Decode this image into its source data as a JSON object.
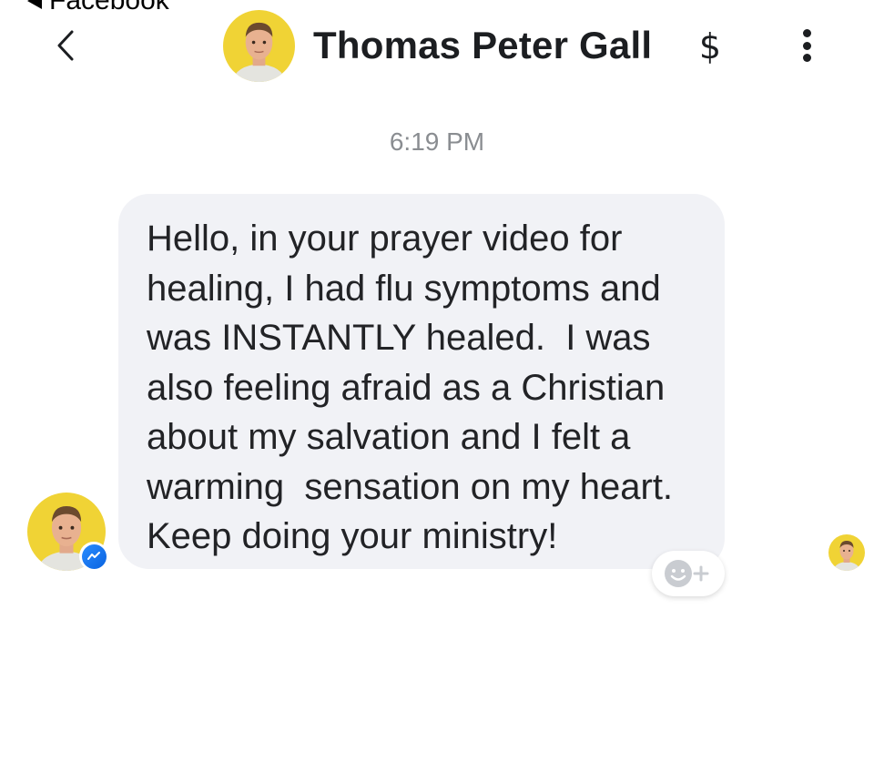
{
  "status_bar": {
    "back_label": "Facebook"
  },
  "header": {
    "contact_name": "Thomas Peter Gall",
    "pay_icon": "dollar-icon",
    "pay_symbol": "$",
    "more_icon": "vertical-ellipsis-icon",
    "back_icon": "chevron-left-icon"
  },
  "conversation": {
    "timestamp": "6:19 PM",
    "messages": [
      {
        "sender": "Thomas Peter Gall",
        "text": "Hello, in your prayer video for\nhealing, I had flu symptoms and\nwas INSTANTLY healed.  I was\nalso feeling afraid as a Christian\nabout my salvation and I felt a\nwarming  sensation on my heart.\nKeep doing your ministry!"
      }
    ],
    "react_icon": "add-reaction-icon",
    "badge_icon": "messenger-icon",
    "read_receipt_icon": "read-receipt-avatar"
  },
  "colors": {
    "bubble_bg": "#f1f2f6",
    "avatar_bg": "#f0d335",
    "messenger_blue": "#0a7cff",
    "timestamp_gray": "#8a8d91"
  }
}
